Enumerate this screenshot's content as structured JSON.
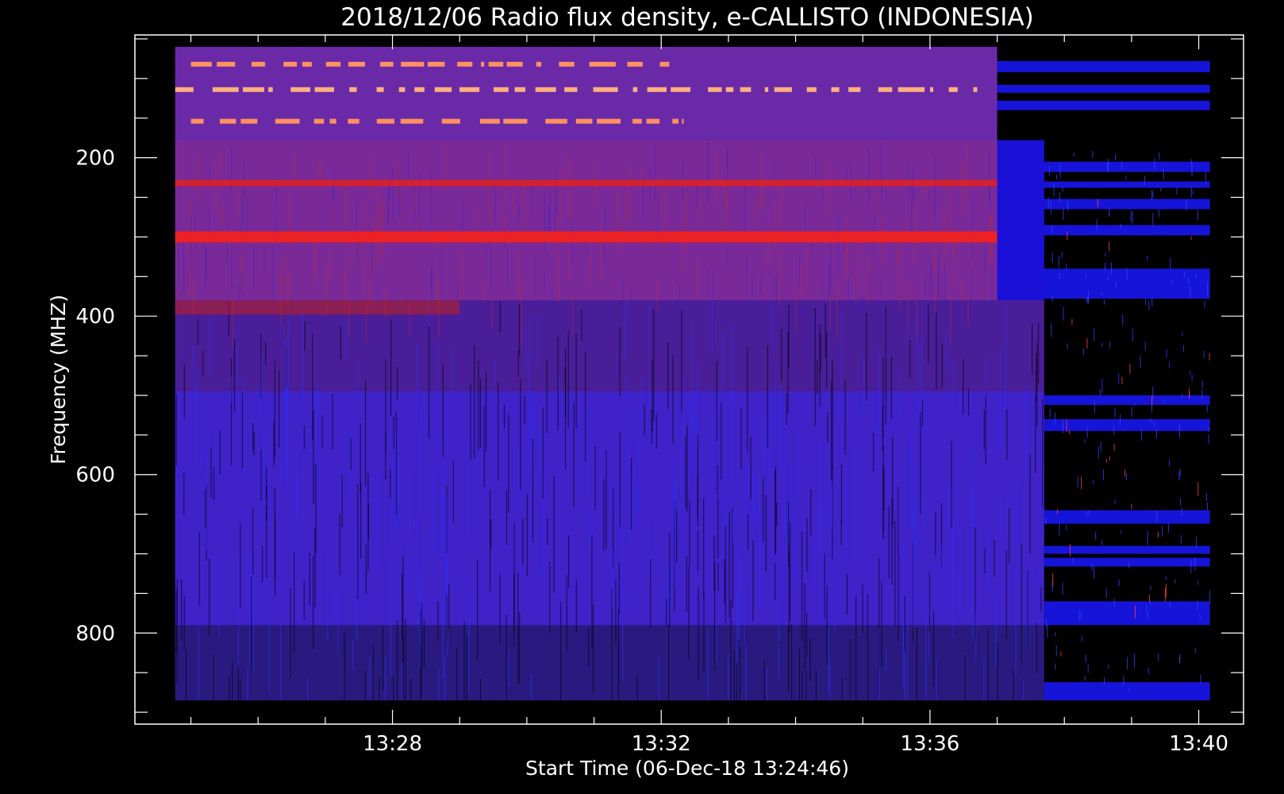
{
  "chart_data": {
    "type": "heatmap",
    "title": "2018/12/06  Radio flux density, e-CALLISTO (INDONESIA)",
    "xlabel": "Start Time (06-Dec-18 13:24:46)",
    "ylabel": "Frequency (MHZ)",
    "x_ticks": [
      "13:28",
      "13:32",
      "13:36",
      "13:40"
    ],
    "y_ticks": [
      "200",
      "400",
      "600",
      "800"
    ],
    "x_range": [
      "13:24:10",
      "13:40:40"
    ],
    "y_range": [
      45,
      915
    ],
    "data_extent": {
      "x": [
        "13:24:46",
        "13:40:10"
      ],
      "y": [
        60,
        885
      ]
    },
    "colormap": [
      "#000000",
      "#1a10ff",
      "#7a2aa0",
      "#ff2010",
      "#ffb060"
    ],
    "features": [
      {
        "label": "bright band",
        "freq": 300,
        "x": [
          "13:24:46",
          "13:37:00"
        ],
        "color": "#ff2010"
      },
      {
        "label": "bright band",
        "freq": 232,
        "x": [
          "13:24:46",
          "13:37:00"
        ],
        "color": "#e02020"
      },
      {
        "label": "dashed band",
        "freq": 82,
        "x": [
          "13:25:00",
          "13:32:20"
        ],
        "color": "#ff9060"
      },
      {
        "label": "dashed band",
        "freq": 114,
        "x": [
          "13:24:46",
          "13:37:00"
        ],
        "color": "#ffb080"
      },
      {
        "label": "dashed band",
        "freq": 154,
        "x": [
          "13:25:00",
          "13:32:20"
        ],
        "color": "#ff9060"
      }
    ],
    "grid": false
  }
}
